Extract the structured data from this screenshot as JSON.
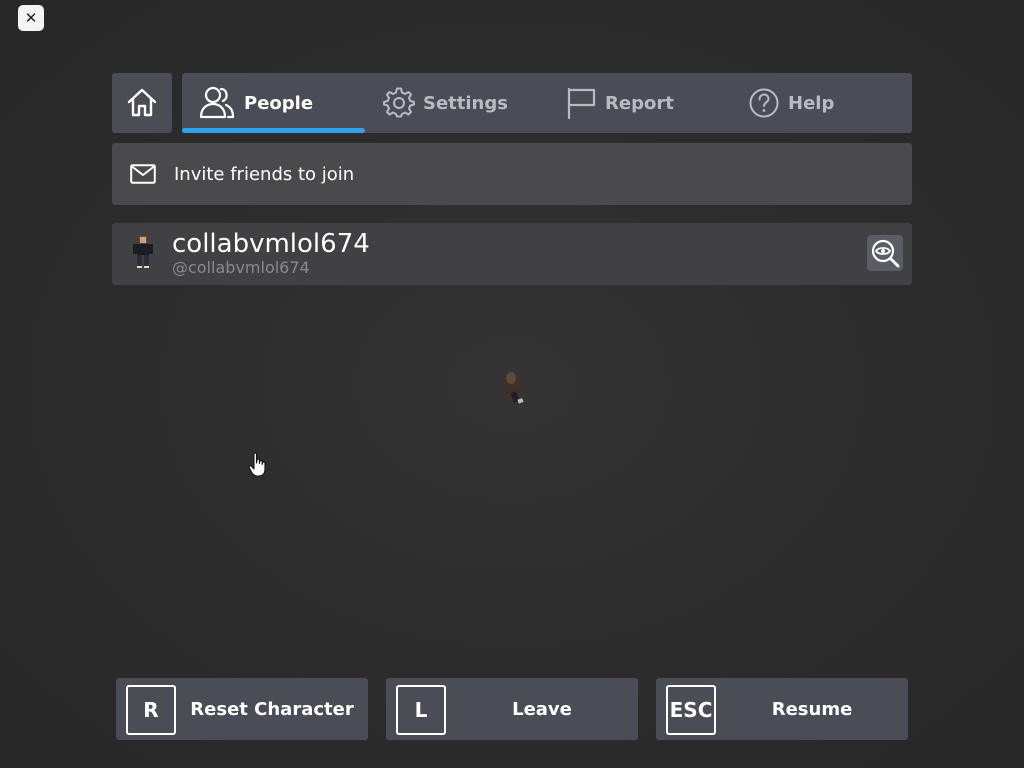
{
  "close_button": {
    "label": "✕"
  },
  "tabs": [
    {
      "label": "People",
      "icon": "people-icon",
      "active": true
    },
    {
      "label": "Settings",
      "icon": "gear-icon",
      "active": false
    },
    {
      "label": "Report",
      "icon": "flag-icon",
      "active": false
    },
    {
      "label": "Help",
      "icon": "help-icon",
      "active": false
    }
  ],
  "invite": {
    "label": "Invite friends to join",
    "icon": "mail-icon"
  },
  "player": {
    "display_name": "collabvmlol674",
    "handle": "@collabvmlol674"
  },
  "bottom_buttons": [
    {
      "key": "R",
      "label": "Reset Character"
    },
    {
      "key": "L",
      "label": "Leave"
    },
    {
      "key": "ESC",
      "label": "Resume"
    }
  ],
  "colors": {
    "accent": "#2fa2ea",
    "panel": "#4a4d56",
    "background": "#2b2b2b"
  }
}
